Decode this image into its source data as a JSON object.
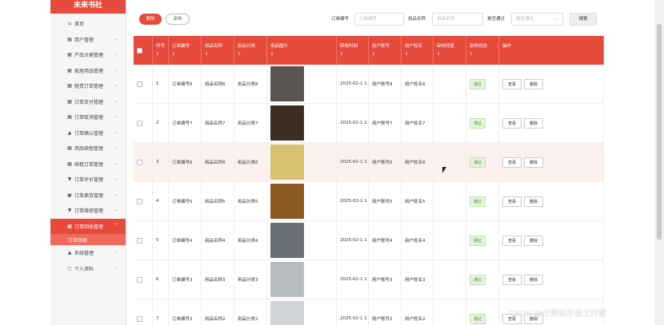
{
  "app": {
    "logo_text": "未来书社"
  },
  "sidebar": {
    "items": [
      {
        "icon": "home-icon",
        "glyph": "⌂",
        "label": "首页",
        "has_chevron": false
      },
      {
        "icon": "user-icon",
        "glyph": "▦",
        "label": "用户管理",
        "has_chevron": true
      },
      {
        "icon": "grid-icon",
        "glyph": "▦",
        "label": "产品分类管理",
        "has_chevron": true
      },
      {
        "icon": "grid-icon",
        "glyph": "▦",
        "label": "家居用品管理",
        "has_chevron": true
      },
      {
        "icon": "grid-icon",
        "glyph": "▦",
        "label": "租赁订单管理",
        "has_chevron": true
      },
      {
        "icon": "grid-icon",
        "glyph": "▦",
        "label": "订单支付管理",
        "has_chevron": true
      },
      {
        "icon": "grid-icon",
        "glyph": "▦",
        "label": "订单取消管理",
        "has_chevron": true
      },
      {
        "icon": "person-icon",
        "glyph": "▲",
        "label": "订单确认管理",
        "has_chevron": true
      },
      {
        "icon": "grid-icon",
        "glyph": "▦",
        "label": "用品续租管理",
        "has_chevron": true
      },
      {
        "icon": "grid-icon",
        "glyph": "▦",
        "label": "续租订单管理",
        "has_chevron": true
      },
      {
        "icon": "chat-icon",
        "glyph": "▼",
        "label": "订单评价管理",
        "has_chevron": true
      },
      {
        "icon": "shop-icon",
        "glyph": "▣",
        "label": "订单换货管理",
        "has_chevron": true
      },
      {
        "icon": "chat-icon",
        "glyph": "▼",
        "label": "订单维修管理",
        "has_chevron": true
      },
      {
        "icon": "grid-icon",
        "glyph": "▦",
        "label": "订单回收管理",
        "has_chevron": true,
        "active": true
      },
      {
        "icon": "person-icon",
        "glyph": "▲",
        "label": "系统管理",
        "has_chevron": true
      },
      {
        "icon": "profile-icon",
        "glyph": "▢",
        "label": "个人资料",
        "has_chevron": true
      }
    ],
    "active_sub": "订单回收"
  },
  "toolbar": {
    "delete_label": "删除",
    "audit_label": "审核",
    "search_label": "搜索"
  },
  "filters": {
    "order_no_label": "订单编号",
    "order_no_placeholder": "订单编号",
    "item_name_label": "用品名称",
    "item_name_placeholder": "用品名称",
    "approved_label": "是否通过",
    "approved_value": "是否通过"
  },
  "table": {
    "headers": [
      "",
      "序号",
      "订单编号",
      "用品名称",
      "用品分类",
      "用品图片",
      "回收时间",
      "用户账号",
      "用户姓名",
      "审核回复",
      "审核状态",
      "操作"
    ],
    "sort_glyph": "⇕",
    "rows": [
      {
        "idx": "1",
        "order": "订单编号8",
        "name": "用品名称8",
        "cat": "用品分类8",
        "time": "2025-02-1 1",
        "acct": "用户账号8",
        "uname": "用户姓名8",
        "status": "通过",
        "img": "#5a5550"
      },
      {
        "idx": "2",
        "order": "订单编号7",
        "name": "用品名称7",
        "cat": "用品分类7",
        "time": "2025-02-1 1",
        "acct": "用户账号7",
        "uname": "用户姓名7",
        "status": "通过",
        "img": "#3a2e22"
      },
      {
        "idx": "3",
        "order": "订单编号6",
        "name": "用品名称6",
        "cat": "用品分类6",
        "time": "2025-02-1 1",
        "acct": "用户账号6",
        "uname": "用户姓名6",
        "status": "通过",
        "img": "#d8c070"
      },
      {
        "idx": "4",
        "order": "订单编号5",
        "name": "用品名称5",
        "cat": "用品分类5",
        "time": "2025-02-1 1",
        "acct": "用户账号5",
        "uname": "用户姓名5",
        "status": "通过",
        "img": "#8a5a20"
      },
      {
        "idx": "5",
        "order": "订单编号4",
        "name": "用品名称4",
        "cat": "用品分类4",
        "time": "2025-02-1 1",
        "acct": "用户账号4",
        "uname": "用户姓名4",
        "status": "通过",
        "img": "#6a7078"
      },
      {
        "idx": "6",
        "order": "订单编号3",
        "name": "用品名称3",
        "cat": "用品分类3",
        "time": "2025-02-1 1",
        "acct": "用户账号3",
        "uname": "用户姓名3",
        "status": "通过",
        "img": "#b8bcc0"
      },
      {
        "idx": "7",
        "order": "订单编号2",
        "name": "用品名称2",
        "cat": "用品分类2",
        "time": "2025-02-1 1",
        "acct": "用户账号2",
        "uname": "用户姓名2",
        "status": "通过",
        "img": "#d0d4d8"
      }
    ],
    "view_label": "查看",
    "del_label": "删除",
    "highlight_row": 2
  },
  "watermark": "CSDN @计算机毕设工作室",
  "colors": {
    "accent": "#e64a3b",
    "badge": "#e6f4df"
  }
}
